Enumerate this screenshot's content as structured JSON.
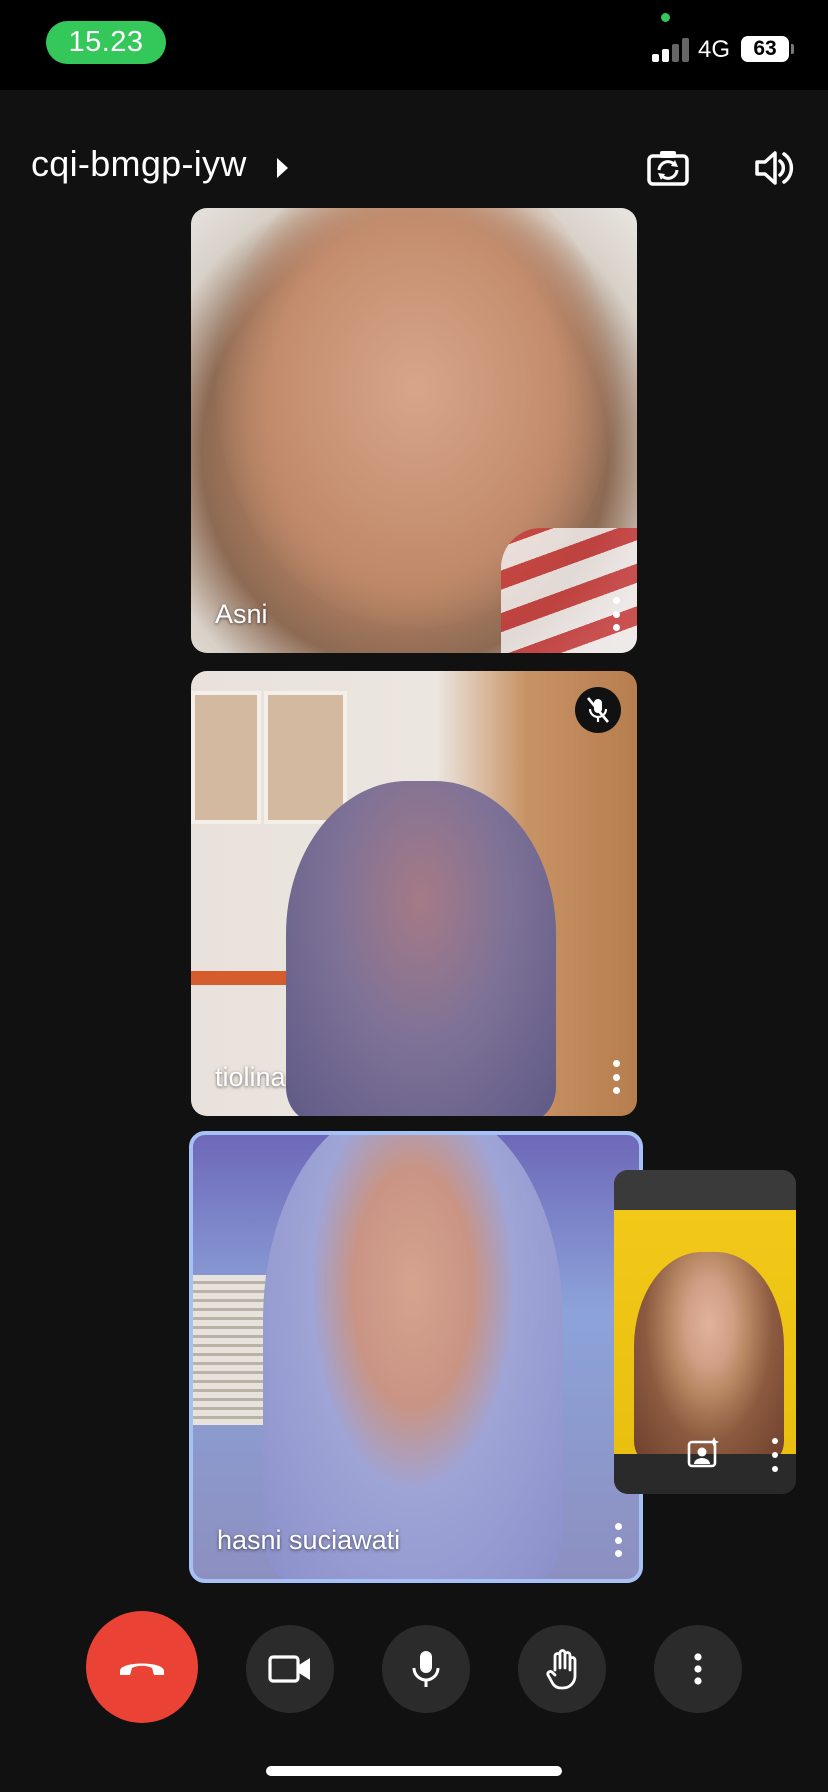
{
  "status_bar": {
    "time": "15.23",
    "network": "4G",
    "battery": "63"
  },
  "header": {
    "meeting_code": "cqi-bmgp-iyw"
  },
  "participants": [
    {
      "name": "Asni",
      "muted": false
    },
    {
      "name": "tiolina",
      "muted": true
    },
    {
      "name": "hasni suciawati",
      "muted": false,
      "active_speaker": true
    }
  ],
  "colors": {
    "end_call": "#ea4335",
    "status_time_pill": "#34c759",
    "active_speaker_border": "#a6c1f5",
    "control_bg": "#2b2b2b"
  },
  "icons": {
    "header": [
      "camera-switch-icon",
      "speaker-icon"
    ],
    "controls": [
      "end-call-icon",
      "camera-icon",
      "microphone-icon",
      "raise-hand-icon",
      "more-options-icon"
    ],
    "self_view": [
      "visual-effects-icon",
      "more-options-icon"
    ]
  }
}
